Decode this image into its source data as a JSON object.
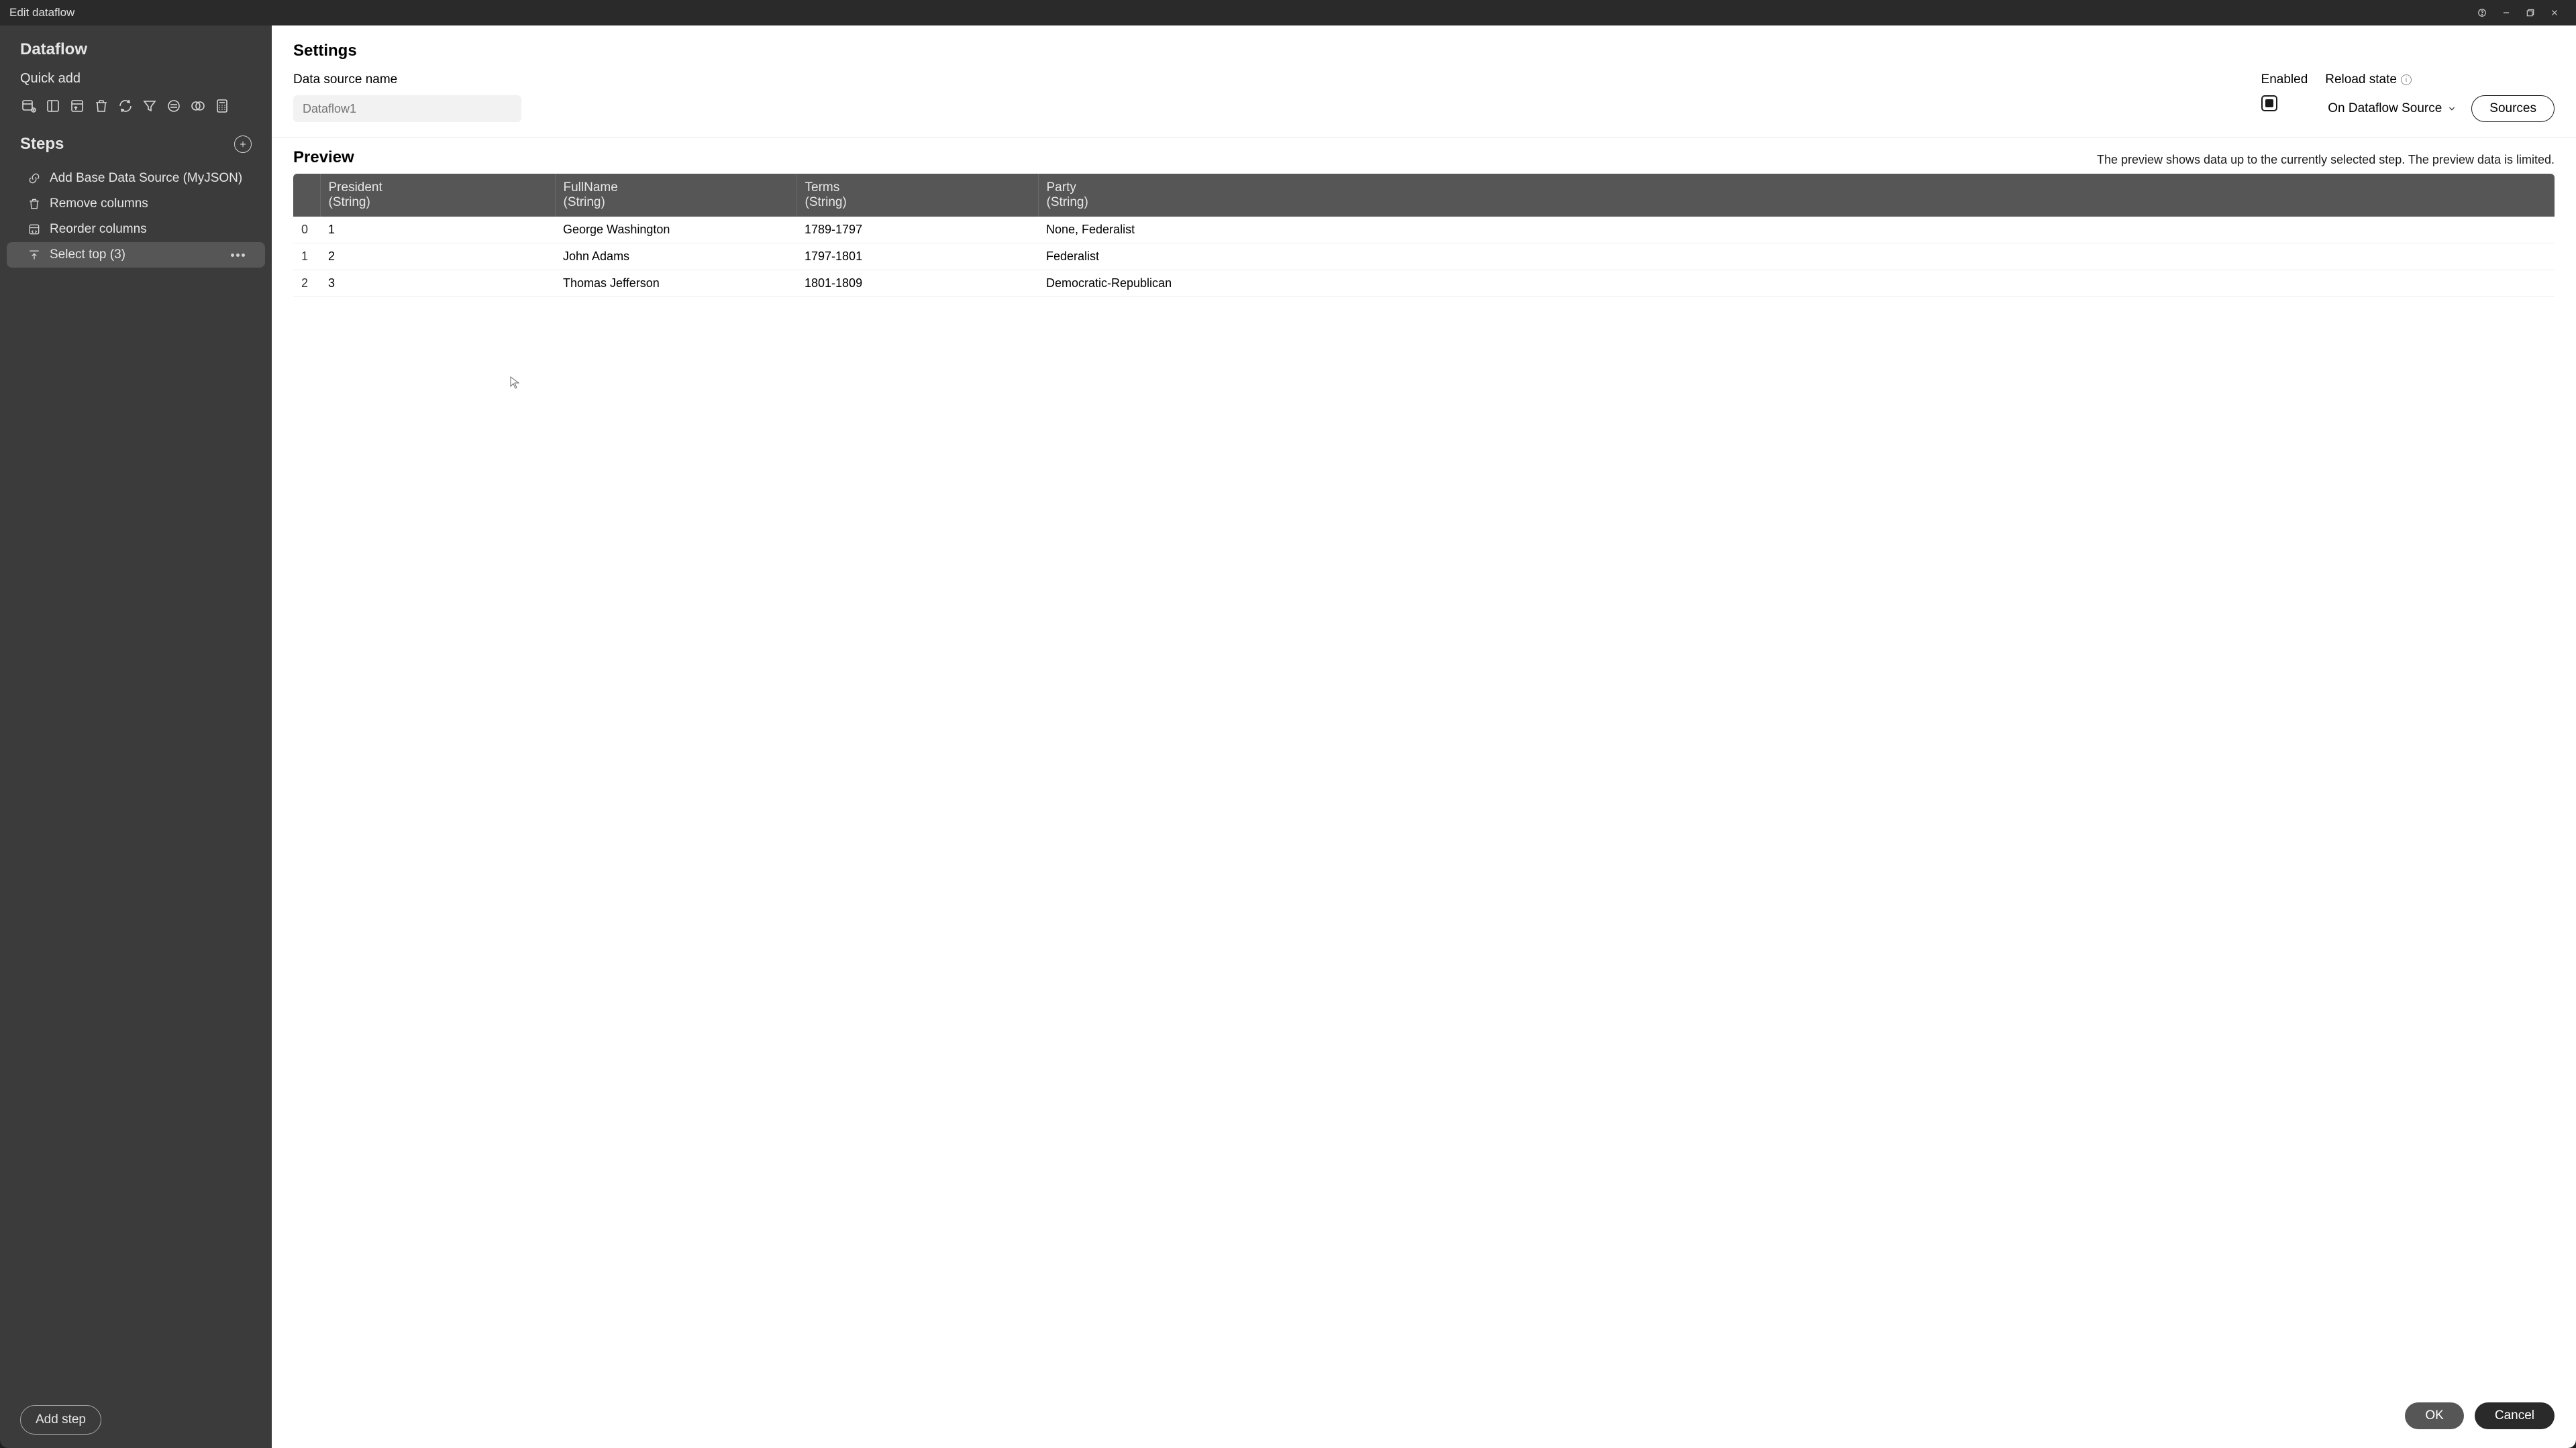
{
  "window": {
    "title": "Edit dataflow"
  },
  "sidebar": {
    "title": "Dataflow",
    "quick_add_label": "Quick add",
    "steps_label": "Steps",
    "steps": [
      {
        "label": "Add Base Data Source (MyJSON)",
        "selected": false,
        "icon": "link"
      },
      {
        "label": "Remove columns",
        "selected": false,
        "icon": "trash"
      },
      {
        "label": "Reorder columns",
        "selected": false,
        "icon": "reorder"
      },
      {
        "label": "Select top (3)",
        "selected": true,
        "icon": "top"
      }
    ],
    "add_step_label": "Add step"
  },
  "settings": {
    "heading": "Settings",
    "data_source_label": "Data source name",
    "data_source_placeholder": "Dataflow1",
    "enabled_label": "Enabled",
    "reload_label": "Reload state",
    "reload_value": "On Dataflow Source",
    "sources_label": "Sources"
  },
  "preview": {
    "heading": "Preview",
    "note": "The preview shows data up to the currently selected step. The preview data is limited.",
    "columns": [
      {
        "name": "President",
        "type": "(String)"
      },
      {
        "name": "FullName",
        "type": "(String)"
      },
      {
        "name": "Terms",
        "type": "(String)"
      },
      {
        "name": "Party",
        "type": "(String)"
      }
    ],
    "rows": [
      {
        "idx": "0",
        "President": "1",
        "FullName": "George Washington",
        "Terms": "1789-1797",
        "Party": "None, Federalist"
      },
      {
        "idx": "1",
        "President": "2",
        "FullName": "John Adams",
        "Terms": "1797-1801",
        "Party": "Federalist"
      },
      {
        "idx": "2",
        "President": "3",
        "FullName": "Thomas Jefferson",
        "Terms": "1801-1809",
        "Party": "Democratic-Republican"
      }
    ]
  },
  "footer": {
    "ok": "OK",
    "cancel": "Cancel"
  }
}
